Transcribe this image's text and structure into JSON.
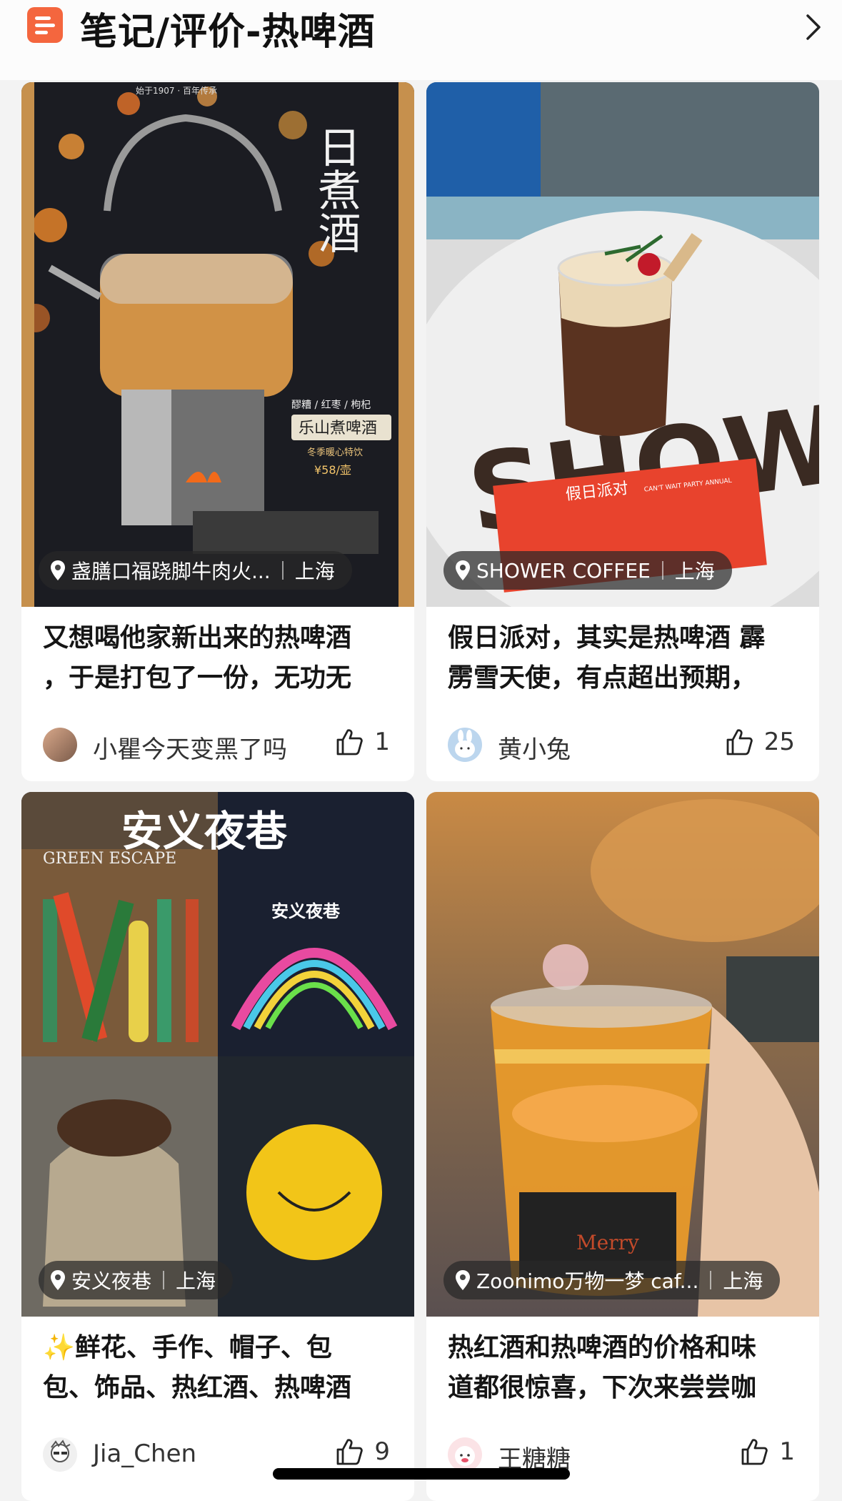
{
  "header": {
    "title": "笔记/评价-热啤酒",
    "icon": "notes-icon",
    "accent": "#f4663e"
  },
  "cards": [
    {
      "photo_text": [
        "始于1907 · 百年传承",
        "日煮酒",
        "醪糟 / 红枣 / 枸杞",
        "乐山煮啤酒",
        "冬季暖心特饮",
        "¥58/壶"
      ],
      "location": "盏膳口福跷脚牛肉火...",
      "city": "上海",
      "title": "又想喝他家新出来的热啤酒\n，于是打包了一份，无功无",
      "author": "小瞿今天变黑了吗",
      "likes": "1"
    },
    {
      "photo_text": [
        "SHOWER",
        "假日派对",
        "CAN'T WAIT PARTY ANNUAL"
      ],
      "location": "SHOWER COFFEE",
      "city": "上海",
      "title": "假日派对，其实是热啤酒 霹\n雳雪天使，有点超出预期，",
      "author": "黄小兔",
      "likes": "25"
    },
    {
      "photo_text": [
        "安义夜巷",
        "GREEN ESCAPE",
        "安义夜巷"
      ],
      "location": "安义夜巷",
      "city": "上海",
      "title": "✨鲜花、手作、帽子、包\n包、饰品、热红酒、热啤酒",
      "author": "Jia_Chen",
      "likes": "9"
    },
    {
      "photo_text": [
        "Merry"
      ],
      "location": "Zoonimo万物一梦 caf...",
      "city": "上海",
      "title": "热红酒和热啤酒的价格和味\n道都很惊喜，下次来尝尝咖",
      "author": "王糖糖",
      "likes": "1"
    }
  ]
}
